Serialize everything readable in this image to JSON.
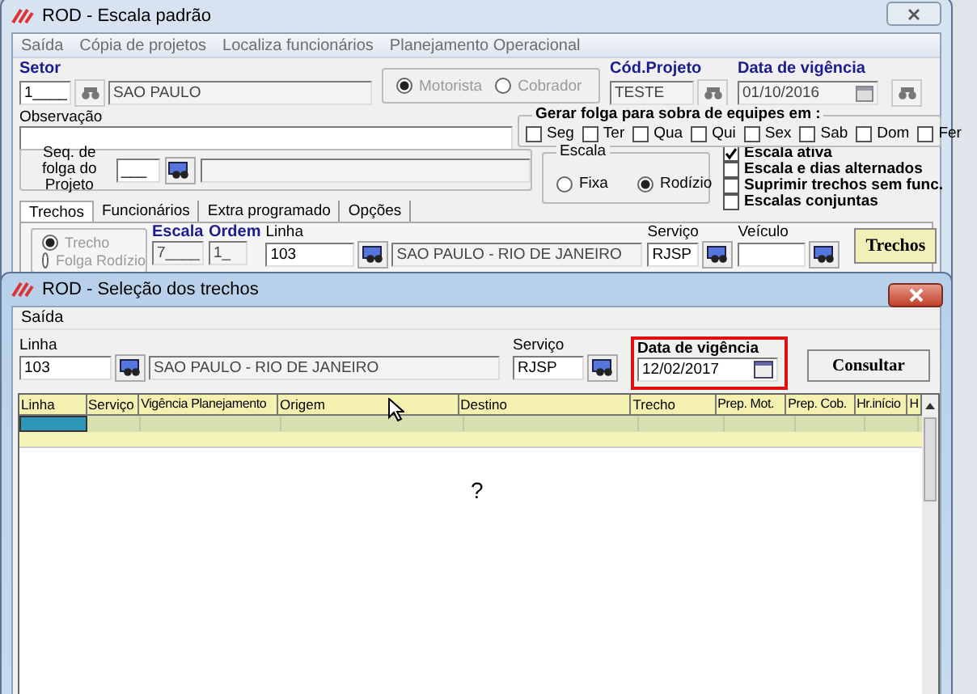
{
  "back_window": {
    "title": "ROD - Escala padrão",
    "menu": [
      "Saída",
      "Cópia de projetos",
      "Localiza funcionários",
      "Planejamento Operacional"
    ],
    "setor": {
      "label": "Setor",
      "code": "1____",
      "name": "SAO PAULO"
    },
    "tipo": [
      {
        "label": "Motorista",
        "selected": true
      },
      {
        "label": "Cobrador",
        "selected": false
      }
    ],
    "cod_projeto": {
      "label": "Cód.Projeto",
      "value": "TESTE"
    },
    "data_vigencia": {
      "label": "Data de vigência",
      "value": "01/10/2016"
    },
    "observacao": {
      "label": "Observação"
    },
    "gerar_folga": {
      "title": "Gerar folga para sobra de equipes em :",
      "days": [
        {
          "label": "Seg",
          "checked": false
        },
        {
          "label": "Ter",
          "checked": false
        },
        {
          "label": "Qua",
          "checked": false
        },
        {
          "label": "Qui",
          "checked": false
        },
        {
          "label": "Sex",
          "checked": false
        },
        {
          "label": "Sab",
          "checked": false
        },
        {
          "label": "Dom",
          "checked": false
        },
        {
          "label": "Fer",
          "checked": false
        }
      ]
    },
    "seq_folga": {
      "label": "Seq. de folga do Projeto",
      "value": "___"
    },
    "escala": {
      "title": "Escala",
      "options": [
        {
          "label": "Fixa",
          "selected": false
        },
        {
          "label": "Rodízio",
          "selected": true
        }
      ]
    },
    "flags": [
      {
        "label": "Escala ativa",
        "checked": true
      },
      {
        "label": "Escala e dias alternados",
        "checked": false
      },
      {
        "label": "Suprimir trechos sem func.",
        "checked": false
      },
      {
        "label": "Escalas conjuntas",
        "checked": false
      }
    ],
    "tabs": [
      {
        "label": "Trechos",
        "selected": true
      },
      {
        "label": "Funcionários",
        "selected": false
      },
      {
        "label": "Extra programado",
        "selected": false
      },
      {
        "label": "Opções",
        "selected": false
      }
    ],
    "modes": [
      {
        "label": "Trecho",
        "selected": true
      },
      {
        "label": "Folga Rodízio",
        "selected": false
      }
    ],
    "escala_field": {
      "label": "Escala",
      "value": "7____"
    },
    "ordem": {
      "label": "Ordem",
      "value": "1_"
    },
    "linha": {
      "label": "Linha",
      "code": "103",
      "name": "SAO PAULO - RIO DE JANEIRO"
    },
    "servico": {
      "label": "Serviço",
      "value": "RJSP"
    },
    "veiculo": {
      "label": "Veículo"
    },
    "button": "Trechos"
  },
  "front_window": {
    "title": "ROD - Seleção dos trechos",
    "menu": [
      "Saída"
    ],
    "linha": {
      "label": "Linha",
      "code": "103",
      "name": "SAO PAULO - RIO DE JANEIRO"
    },
    "servico": {
      "label": "Serviço",
      "value": "RJSP"
    },
    "data_vigencia": {
      "label": "Data de vigência",
      "value": "12/02/2017"
    },
    "button": "Consultar",
    "table": {
      "columns": [
        "Linha",
        "Serviço",
        "Vigência Planejamento",
        "Origem",
        "Destino",
        "Trecho",
        "Prep. Mot.",
        "Prep. Cob.",
        "Hr.início",
        "H"
      ],
      "rows": [
        {
          "selected": true
        }
      ]
    },
    "message": "?"
  }
}
